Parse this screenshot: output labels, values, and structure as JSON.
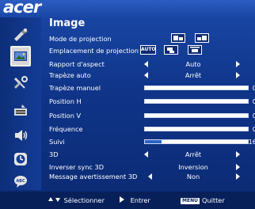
{
  "brand": {
    "logo": "acer"
  },
  "menu": {
    "title": "Image"
  },
  "rows": [
    {
      "label": "Mode de projection",
      "type": "icons"
    },
    {
      "label": "Emplacement de projection",
      "type": "icons",
      "badge": "AUTO"
    },
    {
      "label": "Rapport d'aspect",
      "type": "select",
      "value": "Auto"
    },
    {
      "label": "Trapèze auto",
      "type": "select",
      "value": "Arrêt"
    },
    {
      "label": "Trapèze manuel",
      "type": "slider",
      "level": 0,
      "value": "0"
    },
    {
      "label": "Position H",
      "type": "slider",
      "level": 0,
      "value": "0"
    },
    {
      "label": "Position V",
      "type": "slider",
      "level": 0,
      "value": "0"
    },
    {
      "label": "Fréquence",
      "type": "slider",
      "level": 0,
      "value": "0"
    },
    {
      "label": "Suivi",
      "type": "slider",
      "level": 0.16,
      "value": "16"
    },
    {
      "label": "3D",
      "type": "select",
      "value": "Arrêt"
    },
    {
      "label": "Inverser sync 3D",
      "type": "select",
      "value": "Inversion"
    },
    {
      "label": "Message avertissement 3D",
      "type": "select",
      "value": "Non"
    }
  ],
  "help": {
    "select": "Sélectionner",
    "enter": "Entrer",
    "menu_key": "MENU",
    "quit": "Quitter"
  },
  "sidebar": [
    {
      "icon": "color-tools-icon"
    },
    {
      "icon": "image-icon",
      "active": true
    },
    {
      "icon": "settings-tools-icon"
    },
    {
      "icon": "management-icon"
    },
    {
      "icon": "audio-icon"
    },
    {
      "icon": "timer-icon"
    },
    {
      "icon": "language-icon"
    }
  ],
  "colors": {
    "background": "#0f3488",
    "active_tab": "#d7d7d7",
    "slider_fill": "#2b63c8"
  }
}
